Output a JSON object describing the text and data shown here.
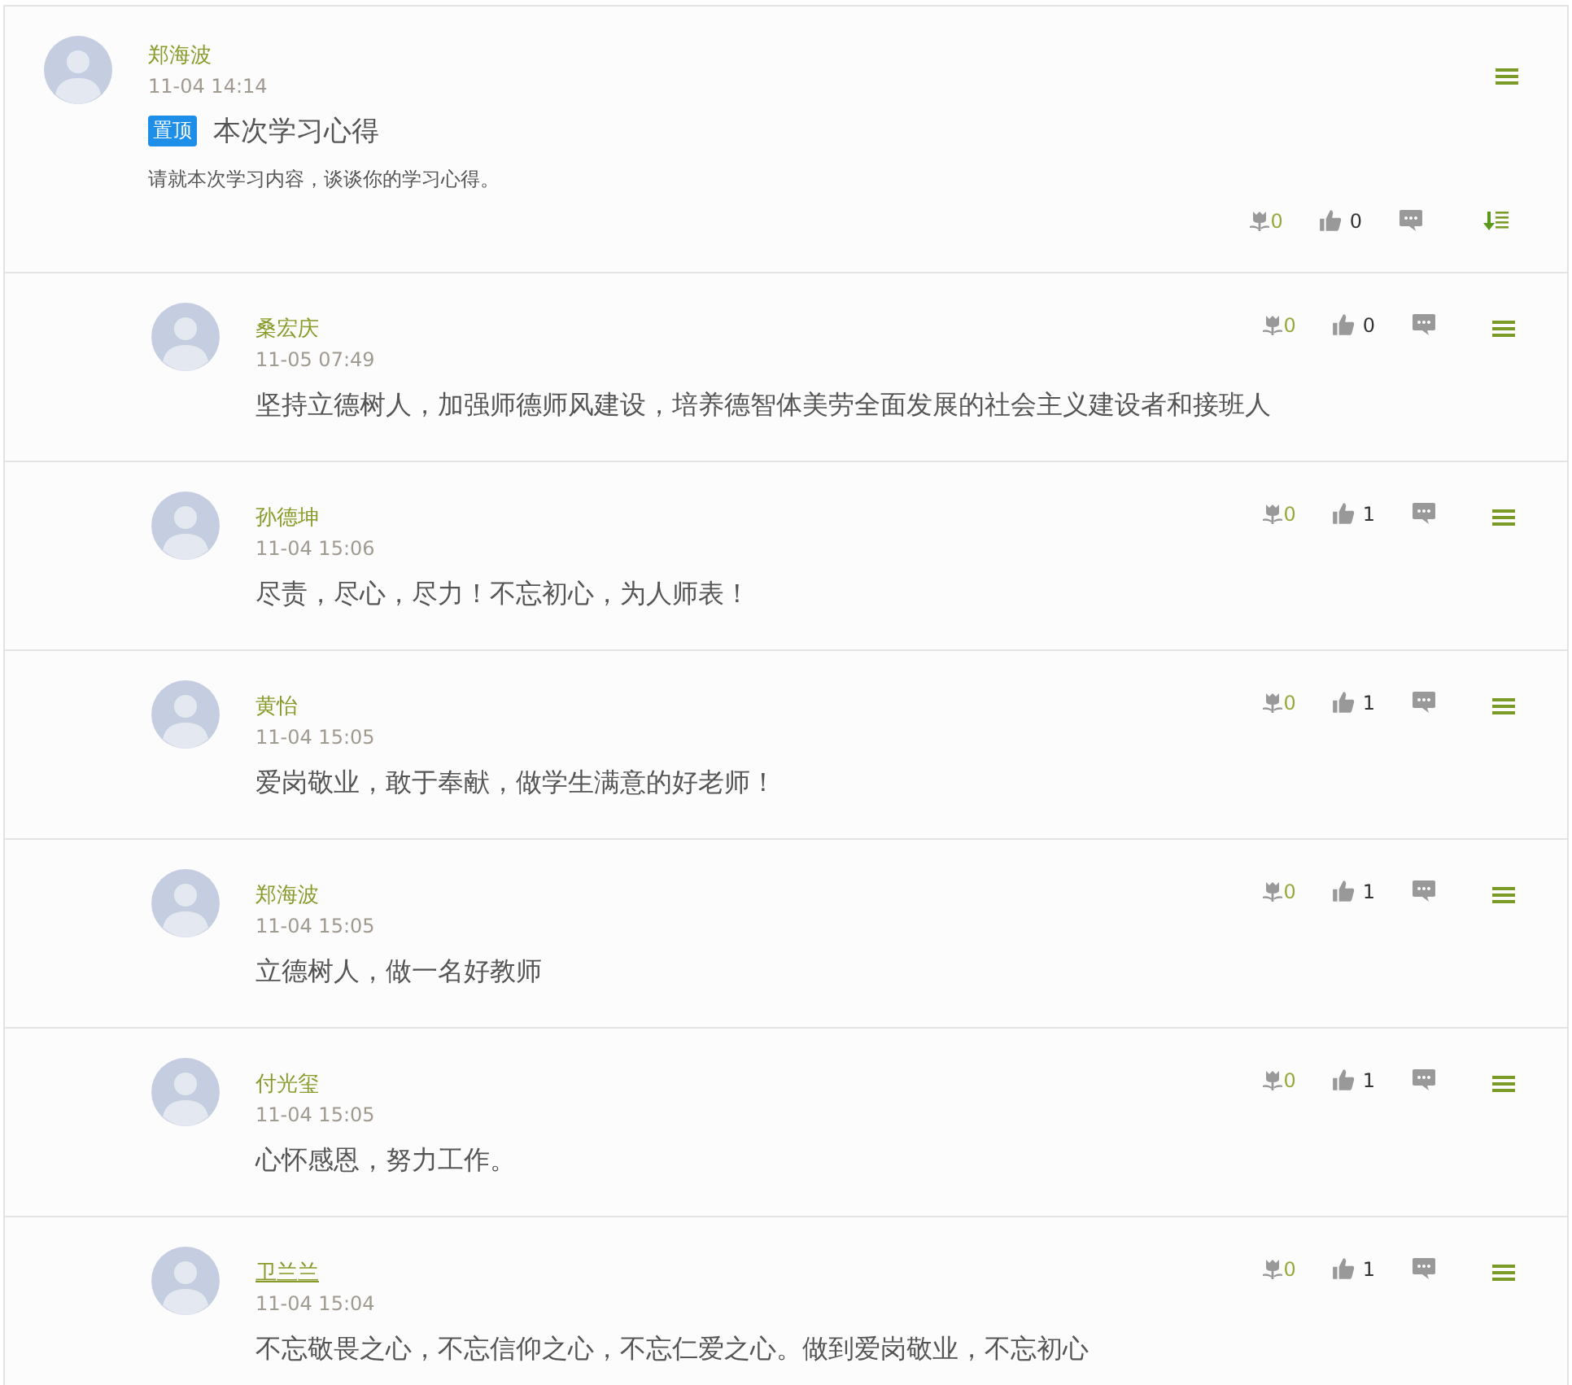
{
  "post": {
    "author": "郑海波",
    "time": "11-04 14:14",
    "badge": "置顶",
    "title": "本次学习心得",
    "body": "请就本次学习内容，谈谈你的学习心得。",
    "flowers": "0",
    "likes": "0"
  },
  "replies": [
    {
      "author": "桑宏庆",
      "time": "11-05 07:49",
      "text": "坚持立德树人，加强师德师风建设，培养德智体美劳全面发展的社会主义建设者和接班人",
      "flowers": "0",
      "likes": "0",
      "hovered": false
    },
    {
      "author": "孙德坤",
      "time": "11-04 15:06",
      "text": "尽责，尽心，尽力！不忘初心，为人师表！",
      "flowers": "0",
      "likes": "1",
      "hovered": false
    },
    {
      "author": "黄怡",
      "time": "11-04 15:05",
      "text": "爱岗敬业，敢于奉献，做学生满意的好老师！",
      "flowers": "0",
      "likes": "1",
      "hovered": false
    },
    {
      "author": "郑海波",
      "time": "11-04 15:05",
      "text": "立德树人，做一名好教师",
      "flowers": "0",
      "likes": "1",
      "hovered": false
    },
    {
      "author": "付光玺",
      "time": "11-04 15:05",
      "text": "心怀感恩，努力工作。",
      "flowers": "0",
      "likes": "1",
      "hovered": false
    },
    {
      "author": "卫兰兰",
      "time": "11-04 15:04",
      "text": "不忘敬畏之心，不忘信仰之心，不忘仁爱之心。做到爱岗敬业，不忘初心",
      "flowers": "0",
      "likes": "1",
      "hovered": true
    }
  ]
}
